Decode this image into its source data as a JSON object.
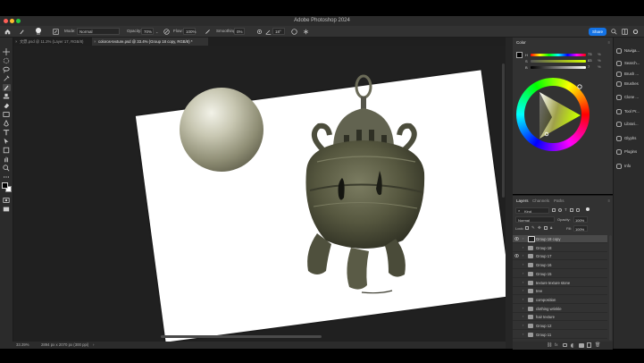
{
  "window": {
    "title": "Adobe Photoshop 2024"
  },
  "options_bar": {
    "mode_label": "Mode:",
    "mode_value": "Normal",
    "opacity_label": "Opacity:",
    "opacity_value": "70%",
    "flow_label": "Flow:",
    "flow_value": "100%",
    "smoothing_label": "Smoothing:",
    "smoothing_value": "0%",
    "angle_value": "18°",
    "brush_size": "50",
    "share_label": "Share"
  },
  "tabs": [
    {
      "label": "文鼎.psd @ 11.2% (Layer 17, RGB/8)",
      "active": false
    },
    {
      "label": "coloros-texture.psd @ 33.4% (Group 18 copy, RGB/8) *",
      "active": true
    }
  ],
  "status_bar": {
    "zoom": "33.39%",
    "doc_info": "2894 px x 2070 px (300 ppi)"
  },
  "color_panel": {
    "tab_label": "Color",
    "sliders": [
      {
        "label": "H",
        "value": "73"
      },
      {
        "label": "S",
        "value": "83"
      },
      {
        "label": "B",
        "value": "7"
      }
    ],
    "unit": "%"
  },
  "layers_panel": {
    "tabs": [
      "Layers",
      "Channels",
      "Paths"
    ],
    "kind_label": "Kind",
    "blend_mode": "Normal",
    "opacity_label": "Opacity:",
    "opacity_value": "100%",
    "lock_label": "Lock:",
    "fill_label": "Fill:",
    "fill_value": "100%",
    "layers": [
      {
        "name": "Group 18 copy",
        "visible": true,
        "selected": true
      },
      {
        "name": "Group 18",
        "visible": false,
        "selected": false
      },
      {
        "name": "Group 17",
        "visible": true,
        "selected": false
      },
      {
        "name": "Group 16",
        "visible": false,
        "selected": false
      },
      {
        "name": "Group 15",
        "visible": false,
        "selected": false
      },
      {
        "name": "texture texture stone",
        "visible": false,
        "selected": false
      },
      {
        "name": "tree",
        "visible": false,
        "selected": false
      },
      {
        "name": "composition",
        "visible": false,
        "selected": false
      },
      {
        "name": "clothing wrinkle",
        "visible": false,
        "selected": false
      },
      {
        "name": "hair texture",
        "visible": false,
        "selected": false
      },
      {
        "name": "Group 12",
        "visible": false,
        "selected": false
      },
      {
        "name": "Group 11",
        "visible": false,
        "selected": false
      }
    ]
  },
  "right_dock": [
    {
      "label": "Naviga...",
      "icon": "compass-icon"
    },
    {
      "label": "Search...",
      "icon": "search-icon"
    },
    {
      "label": "Brush ...",
      "icon": "brush-icon"
    },
    {
      "label": "Brushes",
      "icon": "brushes-icon"
    },
    {
      "label": "Clone ...",
      "icon": "stamp-icon"
    },
    {
      "label": "Tool Pr...",
      "icon": "tool-presets-icon"
    },
    {
      "label": "Librari...",
      "icon": "library-icon"
    },
    {
      "label": "Glyphs",
      "icon": "glyphs-icon"
    },
    {
      "label": "Plugins",
      "icon": "plugin-icon"
    },
    {
      "label": "Info",
      "icon": "info-icon"
    }
  ]
}
